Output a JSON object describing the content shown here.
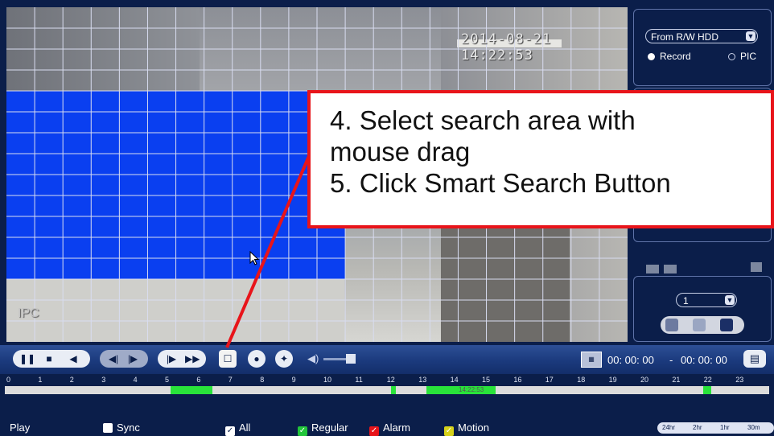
{
  "video": {
    "timestamp": "2014-08-21 14:22:53",
    "channel_label": "IPC"
  },
  "right_panel": {
    "source_value": "From R/W HDD",
    "radio_record": "Record",
    "radio_pic": "PIC",
    "channel_value": "1"
  },
  "annotation": {
    "line1": "4. Select search area with",
    "line2": "mouse drag",
    "line3": "5. Click Smart Search Button"
  },
  "controls": {
    "time_from": "00: 00: 00",
    "time_separator": "-",
    "time_to": "00: 00: 00"
  },
  "timeline": {
    "hours": [
      "0",
      "1",
      "2",
      "3",
      "4",
      "5",
      "6",
      "7",
      "8",
      "9",
      "10",
      "11",
      "12",
      "13",
      "14",
      "15",
      "16",
      "17",
      "18",
      "19",
      "20",
      "21",
      "22",
      "23"
    ],
    "current_time": "14:22:53"
  },
  "legend": {
    "play": "Play",
    "sync": "Sync",
    "all": "All",
    "regular": "Regular",
    "alarm": "Alarm",
    "motion": "Motion",
    "spans": [
      "24hr",
      "2hr",
      "1hr",
      "30m"
    ]
  },
  "colors": {
    "selection": "#0a3ff0",
    "regular": "#22c53a",
    "alarm": "#e8141a",
    "motion": "#d6d21a",
    "callout_border": "#e8141a"
  }
}
